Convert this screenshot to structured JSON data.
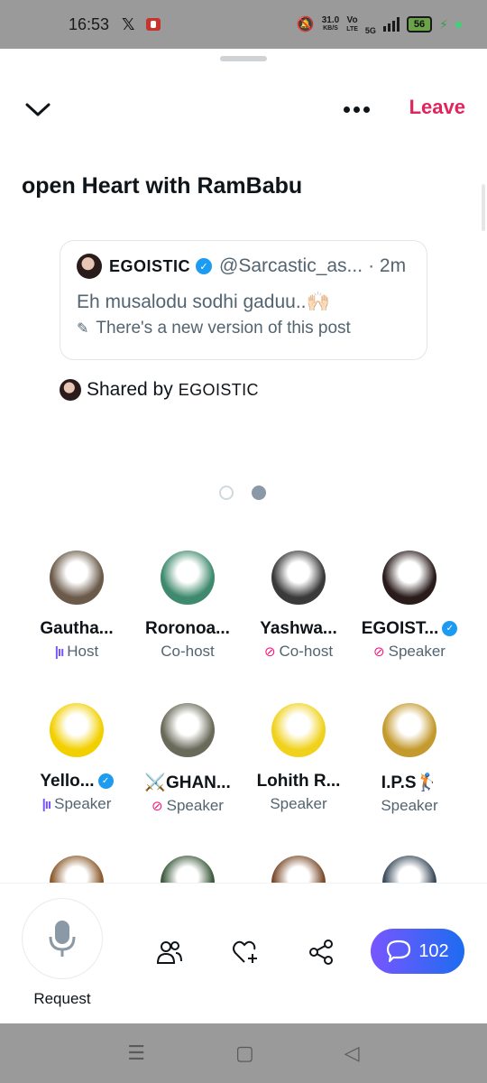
{
  "status_bar": {
    "time": "16:53",
    "x_app": "𝕏",
    "speed_value": "31.0",
    "speed_unit": "KB/S",
    "net_top": "Vo",
    "net_bottom": "LTE",
    "network_type": "5G",
    "battery": "56"
  },
  "header": {
    "leave_label": "Leave"
  },
  "space": {
    "title": "open Heart with RamBabu"
  },
  "post": {
    "author_name": "EGOISTIC",
    "author_handle": "@Sarcastic_as...",
    "time": "· 2m",
    "text": "Eh musalodu sodhi gaduu..🙌🏻",
    "edit_notice": "There's a new version of this post"
  },
  "shared": {
    "prefix": "Shared by",
    "name": "EGOISTIC"
  },
  "participants": [
    {
      "name": "Gautha...",
      "role": "Host",
      "state": "speaking",
      "verified": false,
      "color": "#6b5a4a"
    },
    {
      "name": "Roronoa...",
      "role": "Co-host",
      "state": "none",
      "verified": false,
      "color": "#3f8a6e"
    },
    {
      "name": "Yashwa...",
      "role": "Co-host",
      "state": "muted",
      "verified": false,
      "color": "#3a3a3a"
    },
    {
      "name": "EGOIST...",
      "role": "Speaker",
      "state": "muted",
      "verified": true,
      "color": "#2b1c1c"
    },
    {
      "name": "Yello...",
      "role": "Speaker",
      "state": "speaking",
      "verified": true,
      "color": "#f2d000"
    },
    {
      "name": "⚔️GHAN...",
      "role": "Speaker",
      "state": "muted",
      "verified": false,
      "color": "#6a6a5a"
    },
    {
      "name": "Lohith R...",
      "role": "Speaker",
      "state": "none",
      "verified": false,
      "color": "#f0d21c"
    },
    {
      "name": "I.P.S🏌️",
      "role": "Speaker",
      "state": "none",
      "verified": false,
      "color": "#c49a2e"
    },
    {
      "name": "",
      "role": "",
      "state": "none",
      "verified": false,
      "color": "#8a5a2a"
    },
    {
      "name": "",
      "role": "",
      "state": "none",
      "verified": false,
      "color": "#3c5a3c"
    },
    {
      "name": "",
      "role": "",
      "state": "none",
      "verified": false,
      "color": "#7a4a2a"
    },
    {
      "name": "",
      "role": "",
      "state": "none",
      "verified": false,
      "color": "#3a4a5a"
    }
  ],
  "bottom_bar": {
    "request_label": "Request",
    "comments_count": "102"
  },
  "icons": {
    "mic": "mic-icon",
    "people": "people-icon",
    "heart_plus": "heart-plus-icon",
    "share": "share-icon",
    "comment": "comment-icon"
  },
  "colors": {
    "leave": "#e0245e",
    "verified": "#1d9bf0",
    "comments_start": "#7856ff",
    "comments_end": "#1d6cf0"
  }
}
